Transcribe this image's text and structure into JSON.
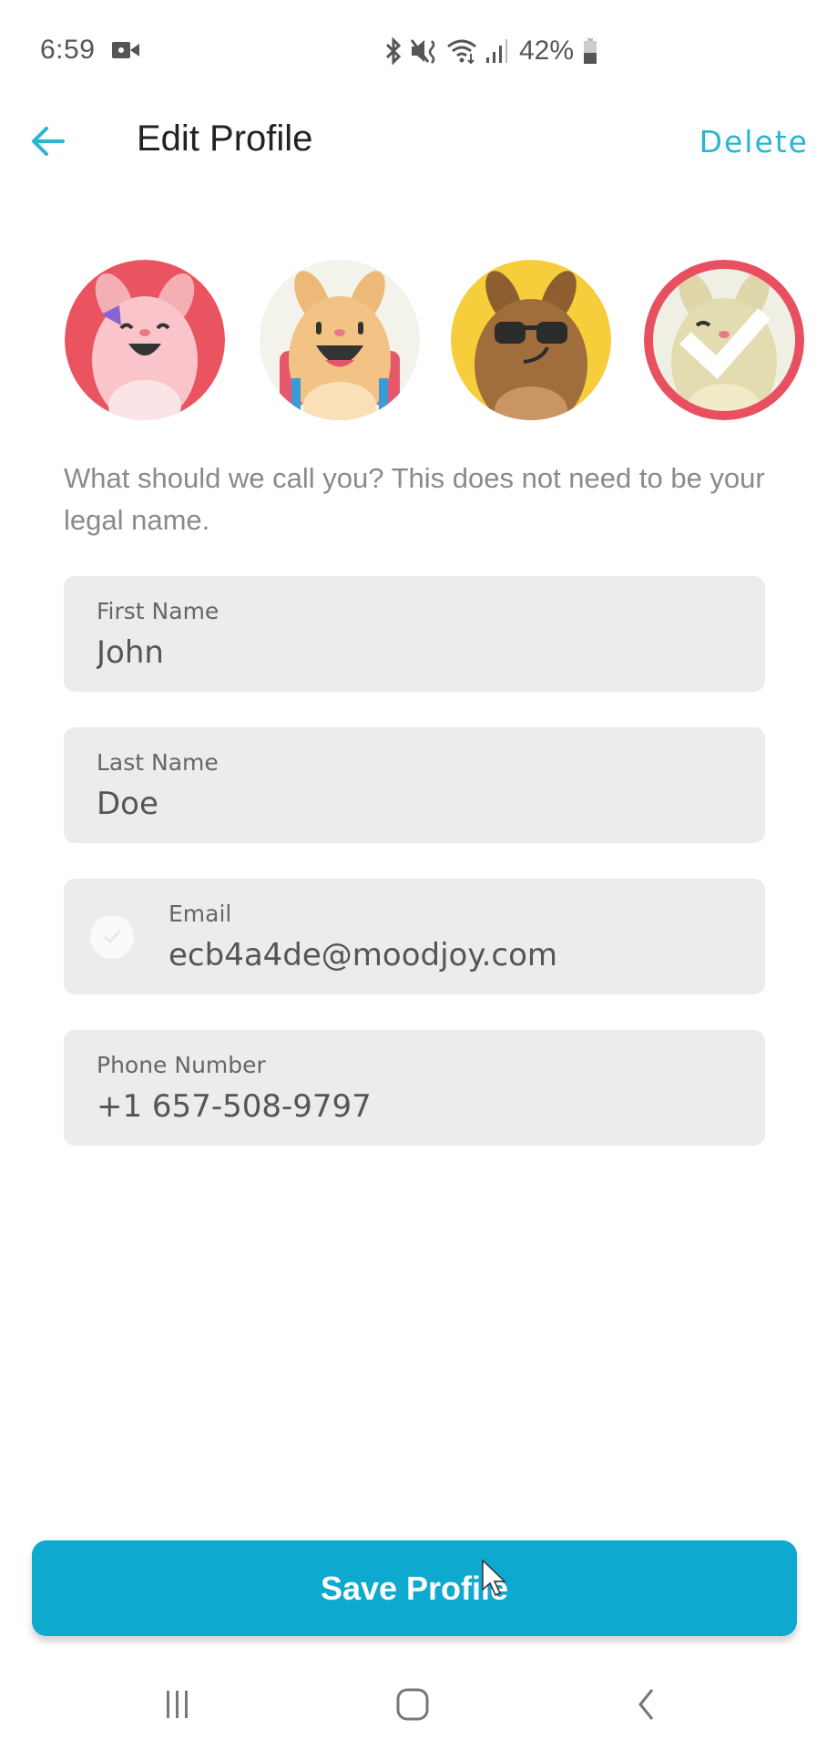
{
  "status_bar": {
    "time": "6:59",
    "battery_percent": "42%",
    "icons": [
      "video-record-icon",
      "bluetooth-icon",
      "mute-vibrate-icon",
      "wifi-icon",
      "signal-icon",
      "battery-icon"
    ]
  },
  "header": {
    "back_icon": "arrow-left-icon",
    "title": "Edit Profile",
    "delete_label": "Delete"
  },
  "avatars": [
    {
      "name": "pink-bunny",
      "bg": "#EA5461",
      "selected": false
    },
    {
      "name": "backpack-bunny",
      "bg": "#F3F3EC",
      "selected": false
    },
    {
      "name": "sunglasses-bunny",
      "bg": "#F6CD3A",
      "selected": false
    },
    {
      "name": "cream-bunny",
      "bg": "#F0EFE3",
      "selected": true
    }
  ],
  "help_text": "What should we call you? This does not need to be your legal name.",
  "fields": {
    "first_name": {
      "label": "First Name",
      "value": "John"
    },
    "last_name": {
      "label": "Last Name",
      "value": "Doe"
    },
    "email": {
      "label": "Email",
      "value": "ecb4a4de@moodjoy.com",
      "icon": "verified-check-icon"
    },
    "phone": {
      "label": "Phone Number",
      "value": "+1 657-508-9797"
    }
  },
  "save_button": {
    "label": "Save Profile"
  },
  "nav_bar": {
    "recents_icon": "recent-apps-icon",
    "home_icon": "home-icon",
    "back_icon": "back-icon"
  },
  "colors": {
    "accent": "#0EA9CE",
    "link": "#29B6CF",
    "selected_ring": "#E84F60",
    "field_bg": "#ECECEC"
  }
}
